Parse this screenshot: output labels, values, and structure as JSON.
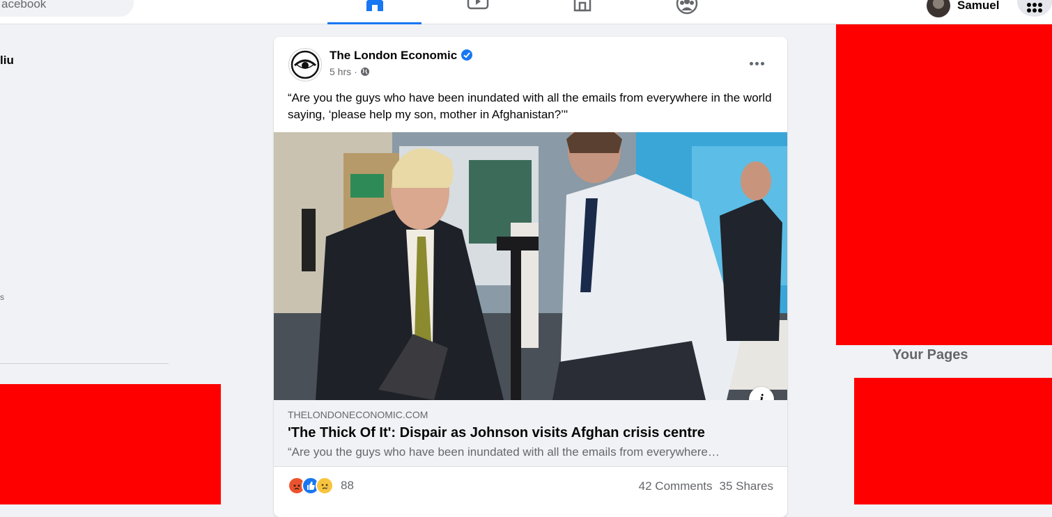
{
  "topbar": {
    "search_placeholder": "acebook",
    "nav_tabs": [
      {
        "icon": "home-icon",
        "active": true
      },
      {
        "icon": "watch-icon",
        "active": false
      },
      {
        "icon": "marketplace-icon",
        "active": false
      },
      {
        "icon": "groups-icon",
        "active": false
      }
    ],
    "profile_name": "Samuel",
    "accent": "#1877f2"
  },
  "left_sidebar": {
    "user_name": "liu",
    "partial_mark": "s"
  },
  "right_sidebar": {
    "your_pages_label": "Your Pages"
  },
  "post": {
    "page_name": "The London Economic",
    "verified": true,
    "time": "5 hrs",
    "separator": "·",
    "audience_icon": "globe-icon",
    "text": "“Are you the guys who have been inundated with all the emails from everywhere in the world saying, ‘please help my son, mother in Afghanistan?’\"",
    "link": {
      "domain": "THELONDONECONOMIC.COM",
      "title": "'The Thick Of It': Dispair as Johnson visits Afghan crisis centre",
      "description": "“Are you the guys who have been inundated with all the emails from everywhere…"
    },
    "info_button": "i",
    "reactions": {
      "types": [
        "angry",
        "like",
        "sad"
      ],
      "count": "88"
    },
    "comments": "42 Comments",
    "shares": "35 Shares"
  },
  "colors": {
    "redacted": "#ff0000",
    "background": "#f0f2f5"
  }
}
